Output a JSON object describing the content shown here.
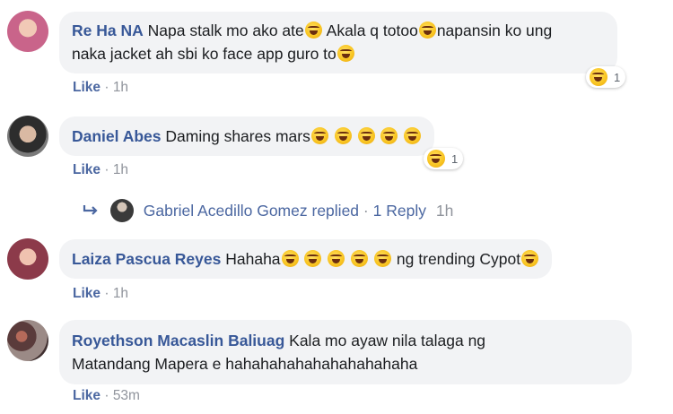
{
  "comments": [
    {
      "author": "Re Ha NA",
      "text_parts": [
        "Napa stalk mo ako ate",
        "Akala q totoo",
        "napansin ko ung",
        "naka jacket ah sbi ko face app guro to"
      ],
      "like_label": "Like",
      "time": "1h",
      "reaction_count": "1"
    },
    {
      "author": "Daniel Abes",
      "text_parts": [
        "Daming shares mars"
      ],
      "like_label": "Like",
      "time": "1h",
      "reaction_count": "1"
    },
    {
      "author": "Laiza Pascua Reyes",
      "text_parts": [
        "Hahaha",
        "ng trending Cypot"
      ],
      "like_label": "Like",
      "time": "1h"
    },
    {
      "author": "Royethson Macaslin Baliuag",
      "text_parts": [
        "Kala mo ayaw nila talaga ng",
        "Matandang Mapera e hahahahahahahahahahaha"
      ],
      "like_label": "Like",
      "time": "53m"
    }
  ],
  "reply_summary": {
    "name": "Gabriel Acedillo Gomez",
    "verb": "replied",
    "count_label": "1 Reply",
    "time": "1h",
    "separator": "·"
  },
  "action_separator": "·",
  "icons": {
    "reaction": "laughing-emoji-icon",
    "reply_arrow": "reply-arrow-icon"
  },
  "colors": {
    "author": "#385898",
    "bubble": "#f2f3f5",
    "meta": "#90949c",
    "link": "#4b67a1"
  }
}
